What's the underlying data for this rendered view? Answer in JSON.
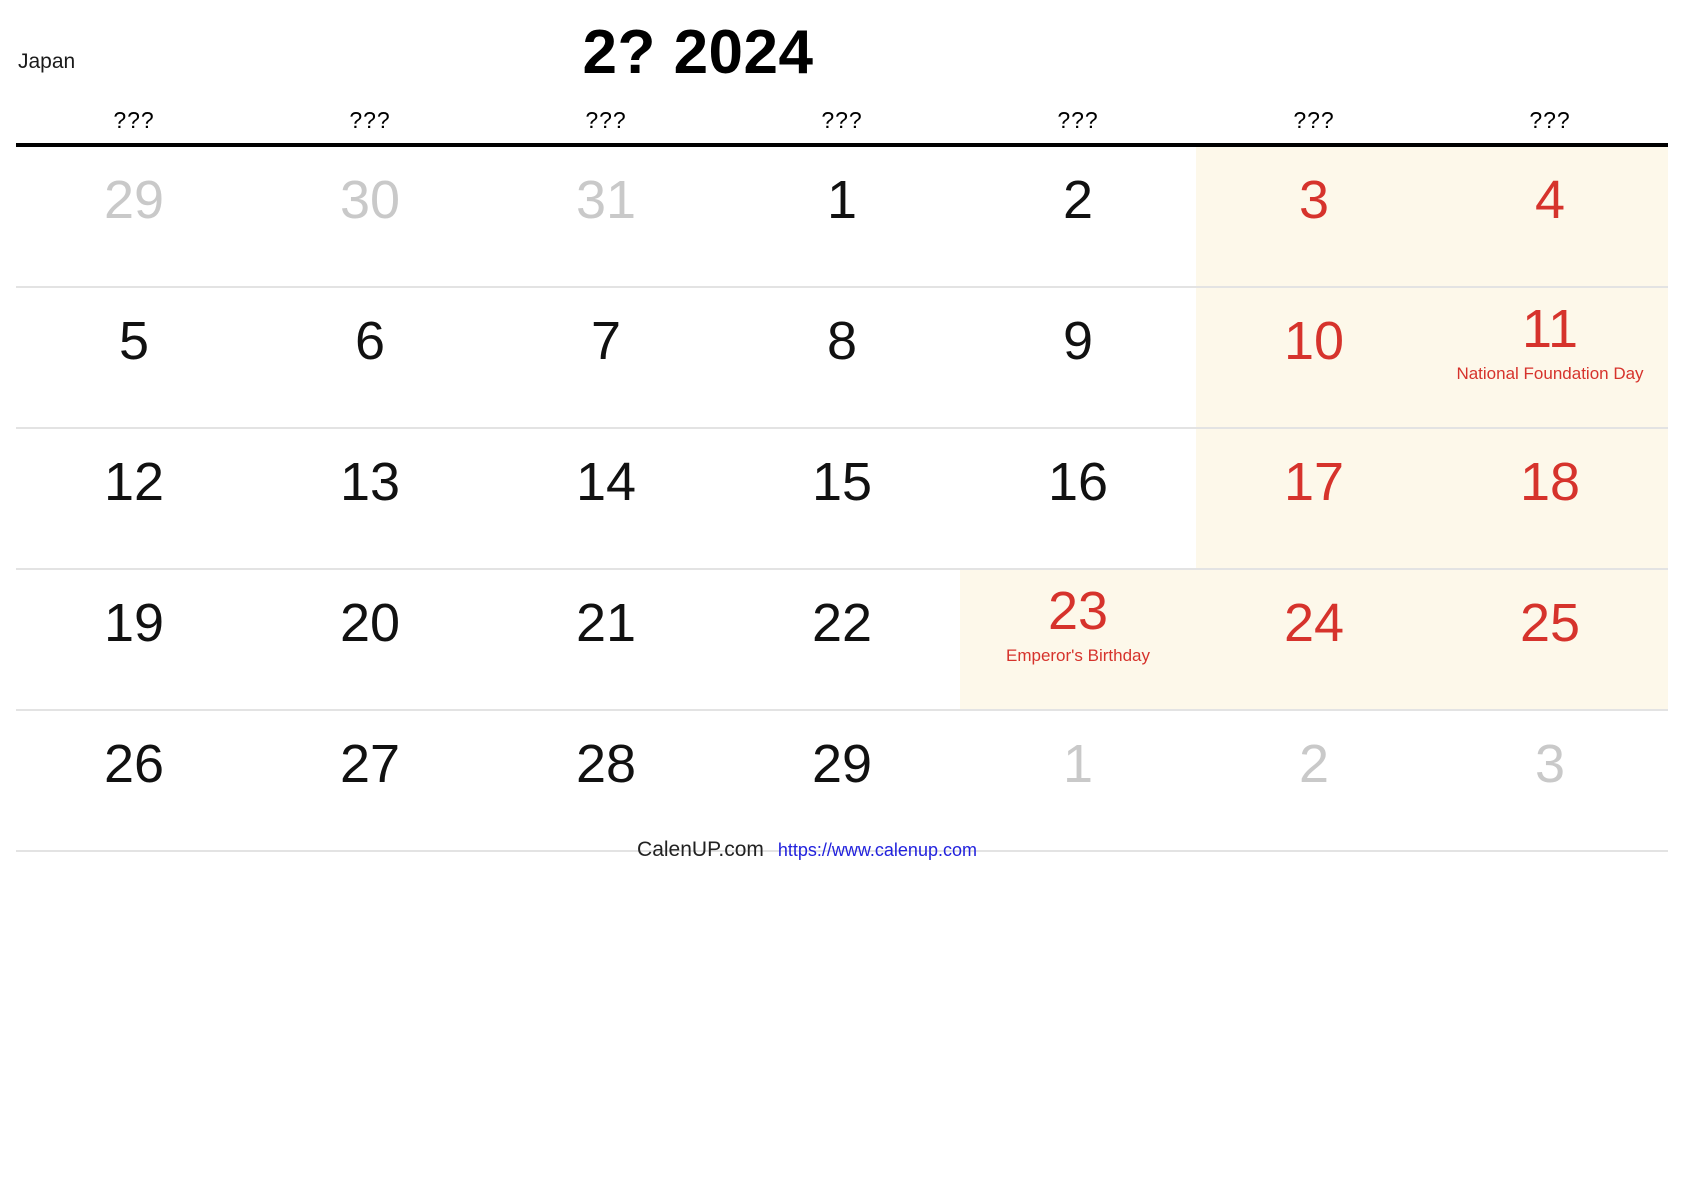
{
  "header": {
    "country_label": "Japan",
    "month_title": "2? 2024"
  },
  "colors": {
    "holiday_text": "#d6332c",
    "weekend_background": "#fdf8ea",
    "outside_month_text": "#c9c9c9",
    "header_rule": "#000000",
    "link": "#2222dd"
  },
  "weekdays": [
    "???",
    "???",
    "???",
    "???",
    "???",
    "???",
    "???"
  ],
  "weeks": [
    [
      {
        "day": "29",
        "outside": true,
        "highlight": false,
        "red": false,
        "event": ""
      },
      {
        "day": "30",
        "outside": true,
        "highlight": false,
        "red": false,
        "event": ""
      },
      {
        "day": "31",
        "outside": true,
        "highlight": false,
        "red": false,
        "event": ""
      },
      {
        "day": "1",
        "outside": false,
        "highlight": false,
        "red": false,
        "event": ""
      },
      {
        "day": "2",
        "outside": false,
        "highlight": false,
        "red": false,
        "event": ""
      },
      {
        "day": "3",
        "outside": false,
        "highlight": true,
        "red": true,
        "event": ""
      },
      {
        "day": "4",
        "outside": false,
        "highlight": true,
        "red": true,
        "event": ""
      }
    ],
    [
      {
        "day": "5",
        "outside": false,
        "highlight": false,
        "red": false,
        "event": ""
      },
      {
        "day": "6",
        "outside": false,
        "highlight": false,
        "red": false,
        "event": ""
      },
      {
        "day": "7",
        "outside": false,
        "highlight": false,
        "red": false,
        "event": ""
      },
      {
        "day": "8",
        "outside": false,
        "highlight": false,
        "red": false,
        "event": ""
      },
      {
        "day": "9",
        "outside": false,
        "highlight": false,
        "red": false,
        "event": ""
      },
      {
        "day": "10",
        "outside": false,
        "highlight": true,
        "red": true,
        "event": ""
      },
      {
        "day": "11",
        "outside": false,
        "highlight": true,
        "red": true,
        "event": "National Foundation Day"
      }
    ],
    [
      {
        "day": "12",
        "outside": false,
        "highlight": false,
        "red": false,
        "event": ""
      },
      {
        "day": "13",
        "outside": false,
        "highlight": false,
        "red": false,
        "event": ""
      },
      {
        "day": "14",
        "outside": false,
        "highlight": false,
        "red": false,
        "event": ""
      },
      {
        "day": "15",
        "outside": false,
        "highlight": false,
        "red": false,
        "event": ""
      },
      {
        "day": "16",
        "outside": false,
        "highlight": false,
        "red": false,
        "event": ""
      },
      {
        "day": "17",
        "outside": false,
        "highlight": true,
        "red": true,
        "event": ""
      },
      {
        "day": "18",
        "outside": false,
        "highlight": true,
        "red": true,
        "event": ""
      }
    ],
    [
      {
        "day": "19",
        "outside": false,
        "highlight": false,
        "red": false,
        "event": ""
      },
      {
        "day": "20",
        "outside": false,
        "highlight": false,
        "red": false,
        "event": ""
      },
      {
        "day": "21",
        "outside": false,
        "highlight": false,
        "red": false,
        "event": ""
      },
      {
        "day": "22",
        "outside": false,
        "highlight": false,
        "red": false,
        "event": ""
      },
      {
        "day": "23",
        "outside": false,
        "highlight": true,
        "red": true,
        "event": "Emperor's Birthday"
      },
      {
        "day": "24",
        "outside": false,
        "highlight": true,
        "red": true,
        "event": ""
      },
      {
        "day": "25",
        "outside": false,
        "highlight": true,
        "red": true,
        "event": ""
      }
    ],
    [
      {
        "day": "26",
        "outside": false,
        "highlight": false,
        "red": false,
        "event": ""
      },
      {
        "day": "27",
        "outside": false,
        "highlight": false,
        "red": false,
        "event": ""
      },
      {
        "day": "28",
        "outside": false,
        "highlight": false,
        "red": false,
        "event": ""
      },
      {
        "day": "29",
        "outside": false,
        "highlight": false,
        "red": false,
        "event": ""
      },
      {
        "day": "1",
        "outside": true,
        "highlight": false,
        "red": false,
        "event": ""
      },
      {
        "day": "2",
        "outside": true,
        "highlight": false,
        "red": false,
        "event": ""
      },
      {
        "day": "3",
        "outside": true,
        "highlight": false,
        "red": false,
        "event": ""
      }
    ]
  ],
  "footer": {
    "brand": "CalenUP.com",
    "url": "https://www.calenup.com"
  }
}
